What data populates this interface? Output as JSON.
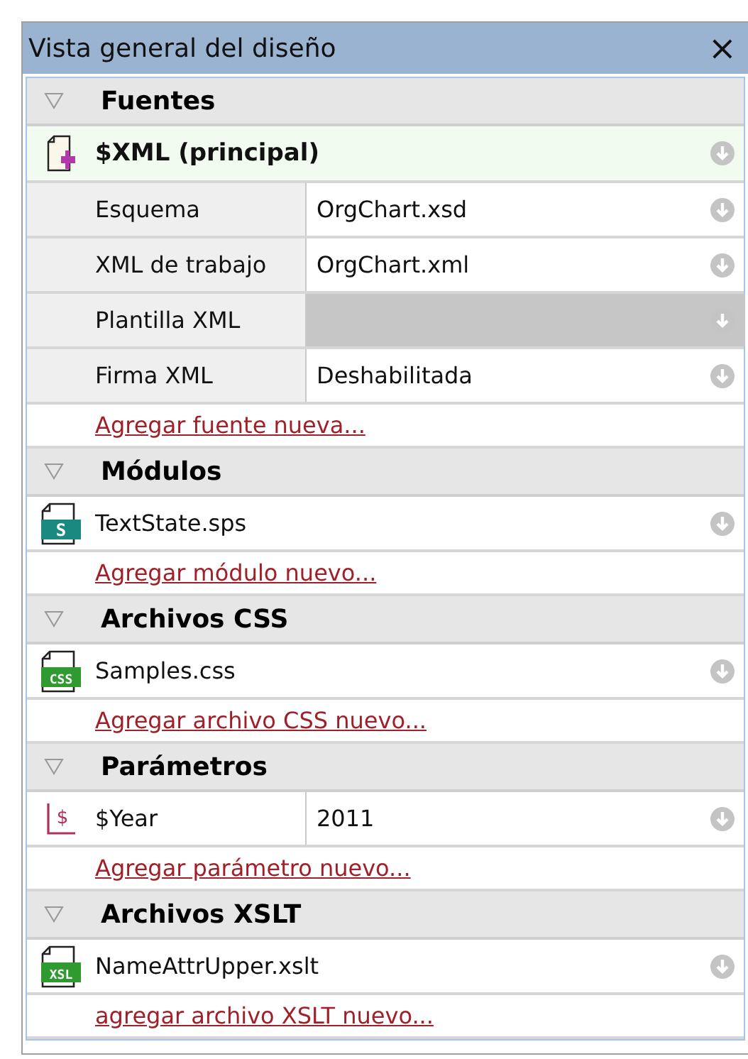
{
  "panel": {
    "title": "Vista general del diseño",
    "close": "×"
  },
  "sections": [
    {
      "title": "Fuentes",
      "expanded": true,
      "items": [
        {
          "kind": "source",
          "label": "$XML (principal)"
        },
        {
          "kind": "property",
          "label": "Esquema",
          "value": "OrgChart.xsd",
          "disabled": false
        },
        {
          "kind": "property",
          "label": "XML de trabajo",
          "value": "OrgChart.xml",
          "disabled": false
        },
        {
          "kind": "property",
          "label": "Plantilla XML",
          "value": "",
          "disabled": true
        },
        {
          "kind": "property",
          "label": "Firma XML",
          "value": "Deshabilitada",
          "disabled": false
        }
      ],
      "add_link": "Agregar fuente nueva..."
    },
    {
      "title": "Módulos",
      "expanded": true,
      "items": [
        {
          "kind": "file",
          "label": "TextState.sps",
          "icon_text": "S",
          "color": "#1a8a80"
        }
      ],
      "add_link": "Agregar módulo nuevo..."
    },
    {
      "title": "Archivos CSS",
      "expanded": true,
      "items": [
        {
          "kind": "file",
          "label": "Samples.css",
          "icon_text": "CSS",
          "color": "#2f9a2f"
        }
      ],
      "add_link": "Agregar archivo CSS nuevo..."
    },
    {
      "title": "Parámetros",
      "expanded": true,
      "items": [
        {
          "kind": "param",
          "label": "$Year",
          "value": "2011",
          "icon_text": "$"
        }
      ],
      "add_link": "Agregar parámetro nuevo..."
    },
    {
      "title": "Archivos XSLT",
      "expanded": true,
      "items": [
        {
          "kind": "file",
          "label": "NameAttrUpper.xslt",
          "icon_text": "XSL",
          "color": "#2f9a2f"
        }
      ],
      "add_link": "agregar archivo XSLT nuevo..."
    }
  ]
}
